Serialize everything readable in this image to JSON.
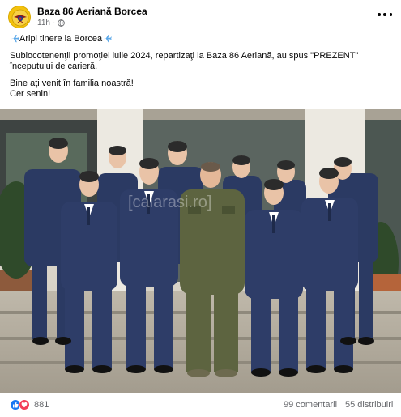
{
  "post": {
    "page_name": "Baza 86 Aeriană Borcea",
    "time": "11h",
    "headline": "Aripi tinere la Borcea",
    "paragraph_1": "Sublocotenenţii promoţiei iulie 2024, repartizaţi la Baza 86 Aeriană, au spus \"PREZENT\" începutului de carieră.",
    "paragraph_2_line_1": "Bine aţi venit în familia noastră!",
    "paragraph_2_line_2": "Cer senin!",
    "photo_watermark": "[calarasi.ro]"
  },
  "engagement": {
    "reaction_count": "881",
    "comments": "99 comentarii",
    "shares": "55 distribuiri"
  },
  "icons": {
    "avatar": "air-base-emblem",
    "audience": "globe-icon",
    "menu": "more-options-icon",
    "emoji": "airplane-icon",
    "reactions": [
      "like-icon",
      "love-icon"
    ]
  },
  "colors": {
    "facebook_blue": "#1877f2",
    "love_red": "#f33e58",
    "secondary_text": "#65676b",
    "uniform_blue": "#2b3a63",
    "flight_suit_green": "#5d6440"
  }
}
